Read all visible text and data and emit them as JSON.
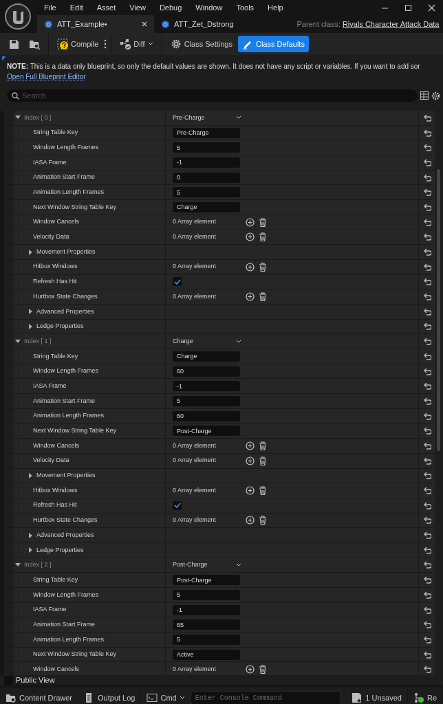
{
  "menu": [
    "File",
    "Edit",
    "Asset",
    "View",
    "Debug",
    "Window",
    "Tools",
    "Help"
  ],
  "tabs": [
    {
      "label": "ATT_Example•",
      "selected": true,
      "closable": true
    },
    {
      "label": "ATT_Zet_Dstrong",
      "selected": false,
      "closable": false
    }
  ],
  "parent_class": {
    "label": "Parent class:",
    "value": "Rivals Character Attack Data"
  },
  "toolbar": [
    {
      "kind": "save"
    },
    {
      "kind": "browse"
    },
    {
      "kind": "compile",
      "label": "Compile"
    },
    {
      "kind": "diff",
      "label": "Diff"
    },
    {
      "kind": "settings",
      "label": "Class Settings",
      "selected": false
    },
    {
      "kind": "defaults",
      "label": "Class Defaults",
      "selected": true
    }
  ],
  "note": {
    "text": "**NOTE:** This is a data only blueprint, so only the default values are shown.  It does not have any script or variables.  If you want to add sor",
    "link": "Open Full Blueprint Editor"
  },
  "search": {
    "placeholder": "Search"
  },
  "groups": [
    {
      "label": "Index [ 0 ]",
      "value": "Pre-Charge",
      "expanded": true,
      "rows": [
        {
          "label": "String Table Key",
          "kind": "text",
          "value": "Pre-Charge"
        },
        {
          "label": "Window Length Frames",
          "kind": "text",
          "value": "5"
        },
        {
          "label": "IASA Frame",
          "kind": "text",
          "value": "-1"
        },
        {
          "label": "Animation Start Frame",
          "kind": "text",
          "value": "0"
        },
        {
          "label": "Animation Length Frames",
          "kind": "text",
          "value": "5"
        },
        {
          "label": "Next Window String Table Key",
          "kind": "text",
          "value": "Charge"
        },
        {
          "label": "Window Cancels",
          "kind": "array",
          "value": "0 Array element"
        },
        {
          "label": "Velocity Data",
          "kind": "array",
          "value": "0 Array element"
        },
        {
          "label": "Movement Properties",
          "kind": "section",
          "expanded": false
        },
        {
          "label": "Hitbox Windows",
          "kind": "array",
          "value": "0 Array element"
        },
        {
          "label": "Refresh Has Hit",
          "kind": "checkbox",
          "checked": true
        },
        {
          "label": "Hurtbox State Changes",
          "kind": "array",
          "value": "0 Array element"
        },
        {
          "label": "Advanced Properties",
          "kind": "section",
          "expanded": false
        },
        {
          "label": "Ledge Properties",
          "kind": "section",
          "expanded": false
        }
      ]
    },
    {
      "label": "Index [ 1 ]",
      "value": "Charge",
      "expanded": true,
      "rows": [
        {
          "label": "String Table Key",
          "kind": "text",
          "value": "Charge"
        },
        {
          "label": "Window Length Frames",
          "kind": "text",
          "value": "60"
        },
        {
          "label": "IASA Frame",
          "kind": "text",
          "value": "-1"
        },
        {
          "label": "Animation Start Frame",
          "kind": "text",
          "value": "5"
        },
        {
          "label": "Animation Length Frames",
          "kind": "text",
          "value": "60"
        },
        {
          "label": "Next Window String Table Key",
          "kind": "text",
          "value": "Post-Charge"
        },
        {
          "label": "Window Cancels",
          "kind": "array",
          "value": "0 Array element"
        },
        {
          "label": "Velocity Data",
          "kind": "array",
          "value": "0 Array element"
        },
        {
          "label": "Movement Properties",
          "kind": "section",
          "expanded": false
        },
        {
          "label": "Hitbox Windows",
          "kind": "array",
          "value": "0 Array element"
        },
        {
          "label": "Refresh Has Hit",
          "kind": "checkbox",
          "checked": true
        },
        {
          "label": "Hurtbox State Changes",
          "kind": "array",
          "value": "0 Array element"
        },
        {
          "label": "Advanced Properties",
          "kind": "section",
          "expanded": false
        },
        {
          "label": "Ledge Properties",
          "kind": "section",
          "expanded": false
        }
      ]
    },
    {
      "label": "Index [ 2 ]",
      "value": "Post-Charge",
      "expanded": true,
      "rows": [
        {
          "label": "String Table Key",
          "kind": "text",
          "value": "Post-Charge"
        },
        {
          "label": "Window Length Frames",
          "kind": "text",
          "value": "5"
        },
        {
          "label": "IASA Frame",
          "kind": "text",
          "value": "-1"
        },
        {
          "label": "Animation Start Frame",
          "kind": "text",
          "value": "65"
        },
        {
          "label": "Animation Length Frames",
          "kind": "text",
          "value": "5"
        },
        {
          "label": "Next Window String Table Key",
          "kind": "text",
          "value": "Active"
        },
        {
          "label": "Window Cancels",
          "kind": "array",
          "value": "0 Array element"
        }
      ]
    }
  ],
  "public_view": {
    "label": "Public View",
    "checked": false
  },
  "status_bar": [
    {
      "kind": "drawer",
      "label": "Content Drawer"
    },
    {
      "kind": "log",
      "label": "Output Log"
    },
    {
      "kind": "cmd",
      "label": "Cmd",
      "placeholder": "Enter Console Command"
    },
    {
      "kind": "unsaved",
      "label": "1 Unsaved"
    },
    {
      "kind": "revision",
      "label": "Re"
    }
  ]
}
